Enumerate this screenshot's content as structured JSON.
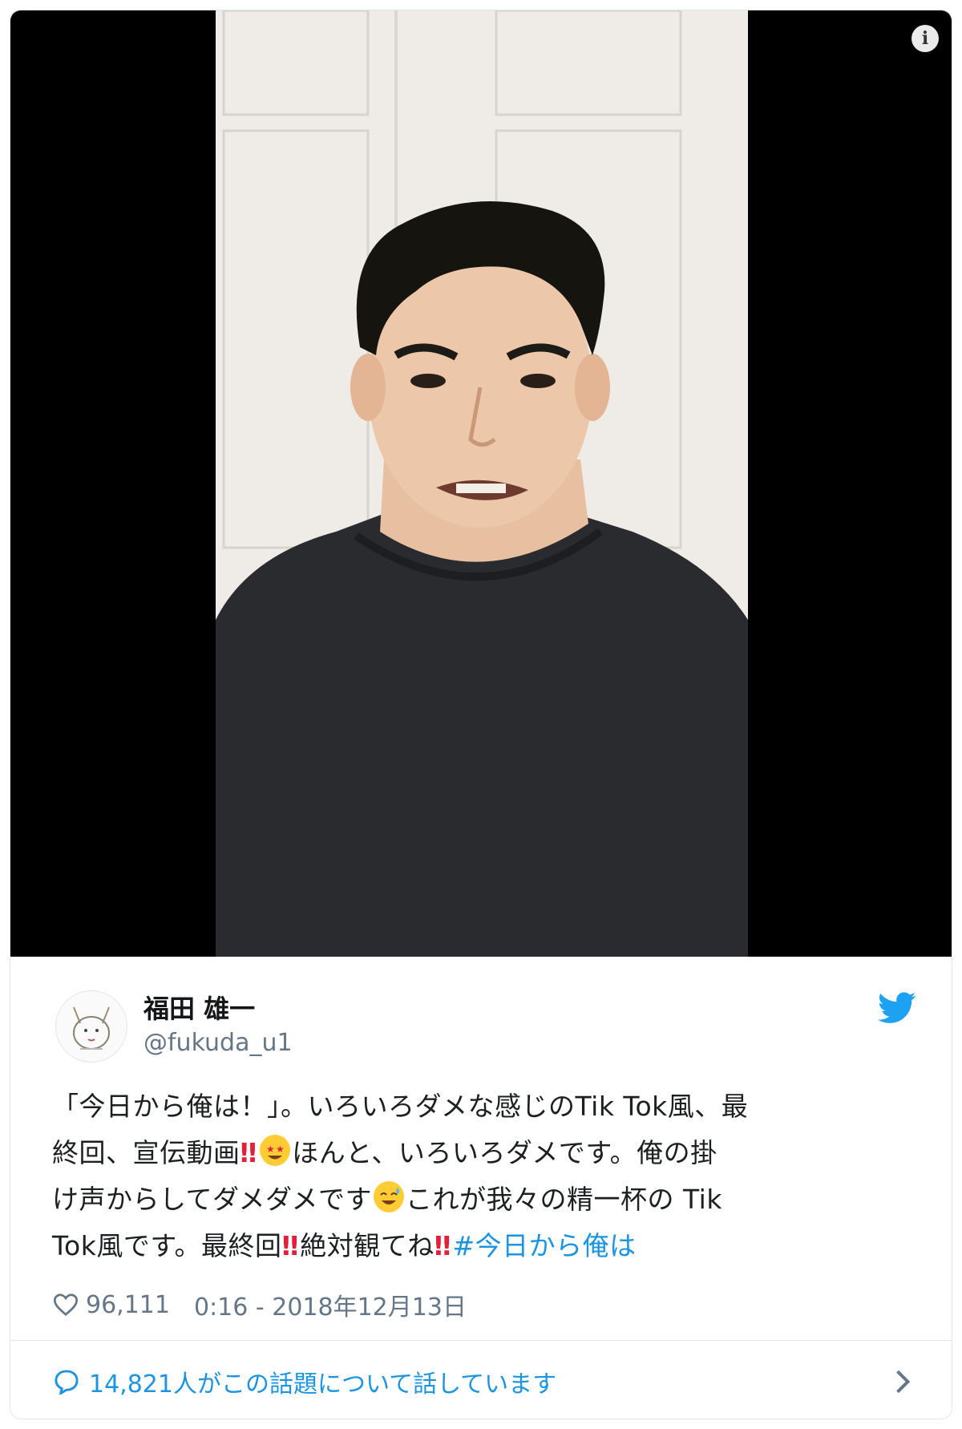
{
  "video": {
    "info_label": "i"
  },
  "tweet": {
    "name": "福田 雄一",
    "handle": "@fukuda_u1",
    "text": {
      "line1": "「今日から俺は！」。いろいろダメな感じのTik Tok風、最",
      "line2a": "終回、宣伝動画",
      "line2b": "ほんと、いろいろダメです。俺の掛",
      "line3a": "け声からしてダメダメです",
      "line3b": "これが我々の精一杯の Tik",
      "line4a": "Tok風です。最終回",
      "line4b": "絶対観てね",
      "hashtag": "#今日から俺は",
      "bang": "‼"
    },
    "likes": "96,111",
    "timestamp": "0:16 - 2018年12月13日",
    "discussion": "14,821人がこの話題について話しています"
  },
  "colors": {
    "accent": "#1b95e0",
    "bang": "#e0213a",
    "muted": "#657786"
  },
  "icons": [
    "info-icon",
    "twitter-bird-icon",
    "heart-icon",
    "speech-bubble-icon",
    "chevron-right-icon",
    "star-eyes-emoji",
    "sweat-smile-emoji"
  ]
}
